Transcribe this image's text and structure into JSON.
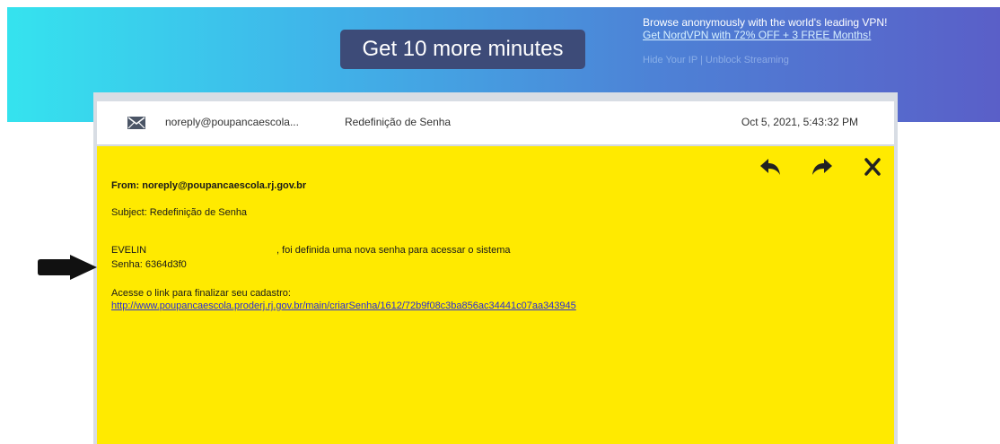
{
  "promo": {
    "button_label": "Get 10 more minutes"
  },
  "vpn_ad": {
    "headline": "Browse anonymously with the world's leading VPN!",
    "link_text": "Get NordVPN with 72% OFF + 3 FREE Months!",
    "footer_text": "Hide Your IP | Unblock Streaming"
  },
  "email_list_item": {
    "sender": "noreply@poupancaescola...",
    "subject": "Redefinição de Senha",
    "timestamp": "Oct 5, 2021, 5:43:32 PM"
  },
  "email": {
    "from_line": "From: noreply@poupancaescola.rj.gov.br",
    "subject_line": "Subject: Redefinição de Senha",
    "greeting_name": "EVELIN",
    "greeting_text": ", foi definida uma nova senha para acessar o sistema",
    "password_line": "Senha: 6364d3f0",
    "access_text": "Acesse o link para finalizar seu cadastro:",
    "link": "http://www.poupancaescola.proderj.rj.gov.br/main/criarSenha/1612/72b9f08c3ba856ac34441c07aa343945"
  },
  "icons": [
    "envelope-icon",
    "reply-icon",
    "forward-icon",
    "close-icon",
    "pointer-arrow-icon"
  ],
  "colors": {
    "email_background": "#ffea00",
    "link": "#2a2dd6",
    "promo_button": "#3d4b78"
  }
}
